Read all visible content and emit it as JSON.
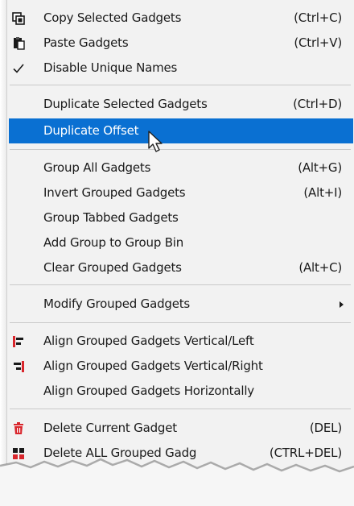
{
  "menu": {
    "items": [
      {
        "label": "Copy Selected Gadgets",
        "shortcut": "(Ctrl+C)",
        "icon": "copy-icon"
      },
      {
        "label": "Paste Gadgets",
        "shortcut": "(Ctrl+V)",
        "icon": "paste-icon"
      },
      {
        "label": "Disable Unique Names",
        "shortcut": "",
        "icon": "checkmark-icon",
        "checked": true
      },
      {
        "label": "Duplicate Selected Gadgets",
        "shortcut": "(Ctrl+D)"
      },
      {
        "label": "Duplicate Offset",
        "shortcut": "",
        "highlighted": true
      },
      {
        "label": "Group All Gadgets",
        "shortcut": "(Alt+G)"
      },
      {
        "label": "Invert Grouped Gadgets",
        "shortcut": "(Alt+I)"
      },
      {
        "label": "Group Tabbed Gadgets",
        "shortcut": ""
      },
      {
        "label": "Add Group to Group Bin",
        "shortcut": ""
      },
      {
        "label": "Clear Grouped Gadgets",
        "shortcut": "(Alt+C)"
      },
      {
        "label": "Modify Grouped Gadgets",
        "shortcut": "",
        "submenu": true
      },
      {
        "label": "Align Grouped Gadgets Vertical/Left",
        "shortcut": "",
        "icon": "align-left-icon"
      },
      {
        "label": "Align Grouped Gadgets Vertical/Right",
        "shortcut": "",
        "icon": "align-right-icon"
      },
      {
        "label": "Align Grouped Gadgets Horizontally",
        "shortcut": ""
      },
      {
        "label": "Delete Current Gadget",
        "shortcut": "(DEL)",
        "icon": "trash-icon"
      },
      {
        "label": "Delete ALL Grouped Gadg",
        "shortcut": "(CTRL+DEL)",
        "icon": "grid-delete-icon"
      }
    ]
  },
  "colors": {
    "highlight": "#0a70d2",
    "menu_bg": "#f2f2f2",
    "separator": "#c9c9c9",
    "icon_red": "#d9262c"
  }
}
